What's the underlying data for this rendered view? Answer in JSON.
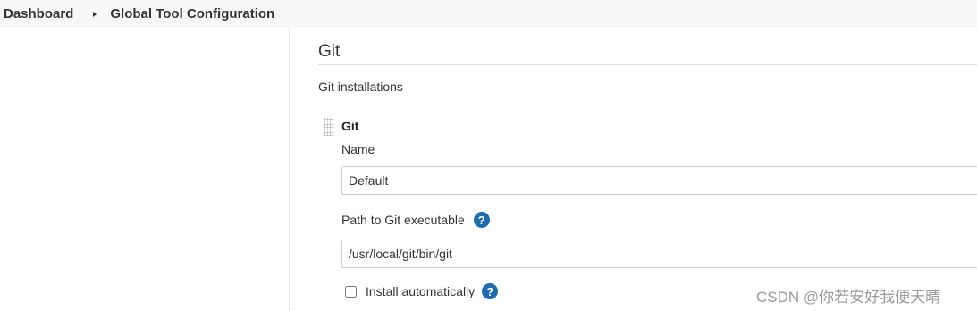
{
  "breadcrumb": {
    "items": [
      "Dashboard",
      "Global Tool Configuration"
    ]
  },
  "section": {
    "title": "Git",
    "installations_label": "Git installations"
  },
  "installation": {
    "title": "Git",
    "name_label": "Name",
    "name_value": "Default",
    "path_label": "Path to Git executable",
    "path_value": "/usr/local/git/bin/git",
    "install_automatically_label": "Install automatically",
    "install_automatically_checked": false
  },
  "icons": {
    "help": "?",
    "breadcrumb_separator": "caret-right-icon",
    "drag_handle": "drag-handle-icon"
  },
  "colors": {
    "help_icon": "#1e6cad",
    "breadcrumb_bg": "#f7f7f7"
  },
  "watermark": "CSDN @你若安好我便天晴"
}
